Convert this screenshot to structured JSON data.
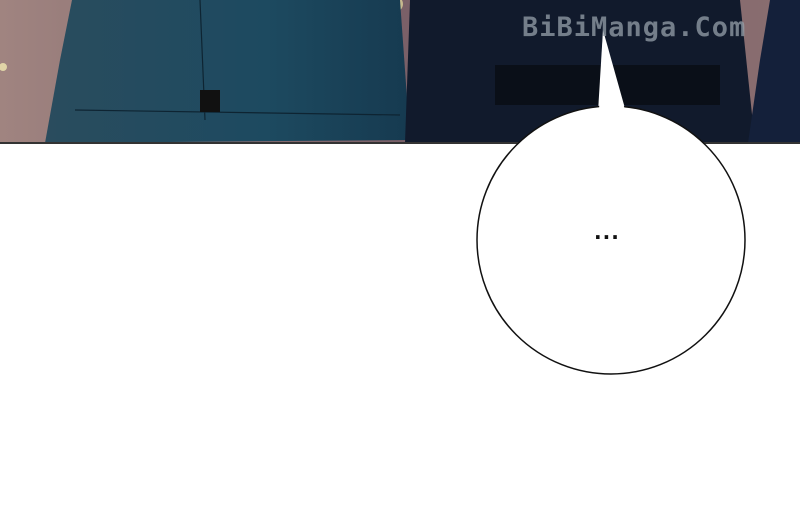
{
  "watermark": "BiBiManga.Com",
  "speech_bubble": {
    "text": "..."
  },
  "colors": {
    "background": "#ffffff",
    "cloak": "#1f4a5e",
    "suit": "#0f1a2e",
    "backdrop": "#8c7474"
  }
}
